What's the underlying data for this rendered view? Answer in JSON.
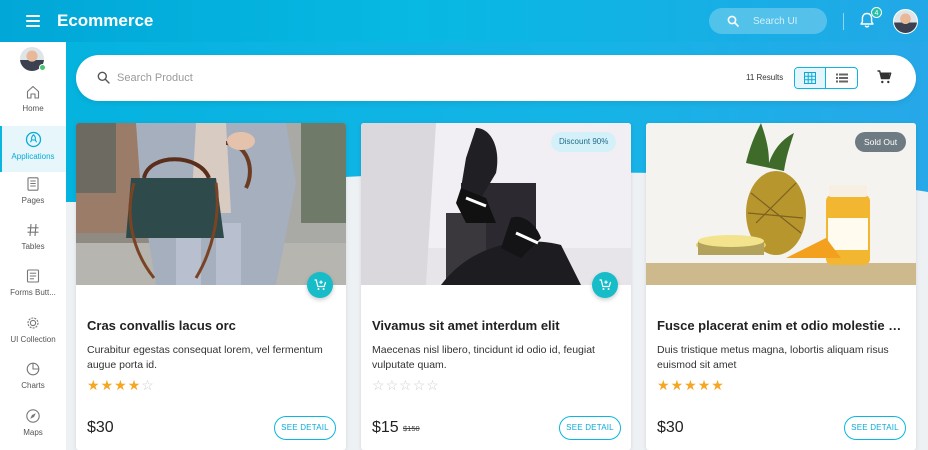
{
  "header": {
    "title": "Ecommerce",
    "search_placeholder": "Search UI",
    "notification_count": "4"
  },
  "sidebar": {
    "items": [
      {
        "label": "Home",
        "icon": "home-icon"
      },
      {
        "label": "Applications",
        "icon": "rocket-icon",
        "active": true
      },
      {
        "label": "Pages",
        "icon": "pages-icon"
      },
      {
        "label": "Tables",
        "icon": "hash-icon"
      },
      {
        "label": "Forms Butt...",
        "icon": "form-icon"
      },
      {
        "label": "UI Collection",
        "icon": "gear-icon"
      },
      {
        "label": "Charts",
        "icon": "chart-icon"
      },
      {
        "label": "Maps",
        "icon": "compass-icon"
      }
    ]
  },
  "toolbar": {
    "search_placeholder": "Search Product",
    "results": "11 Results",
    "view_mode": "grid"
  },
  "products": [
    {
      "title": "Cras convallis lacus orc",
      "description": "Curabitur egestas consequat lorem, vel fermentum augue porta id.",
      "rating": 4,
      "price": "$30",
      "old_price": "",
      "badge": "",
      "detail_label": "SEE DETAIL"
    },
    {
      "title": "Vivamus sit amet interdum elit",
      "description": "Maecenas nisl libero, tincidunt id odio id, feugiat vulputate quam.",
      "rating": 0,
      "price": "$15",
      "old_price": "$150",
      "badge": "Discount 90%",
      "detail_label": "SEE DETAIL"
    },
    {
      "title": "Fusce placerat enim et odio molestie sagittis.",
      "description": "Duis tristique metus magna, lobortis aliquam risus euismod sit amet",
      "rating": 5,
      "price": "$30",
      "old_price": "",
      "badge": "Sold Out",
      "detail_label": "SEE DETAIL"
    }
  ],
  "colors": {
    "accent": "#0ab5e0",
    "star": "#f5a623",
    "cart_button": "#17bcc9"
  }
}
